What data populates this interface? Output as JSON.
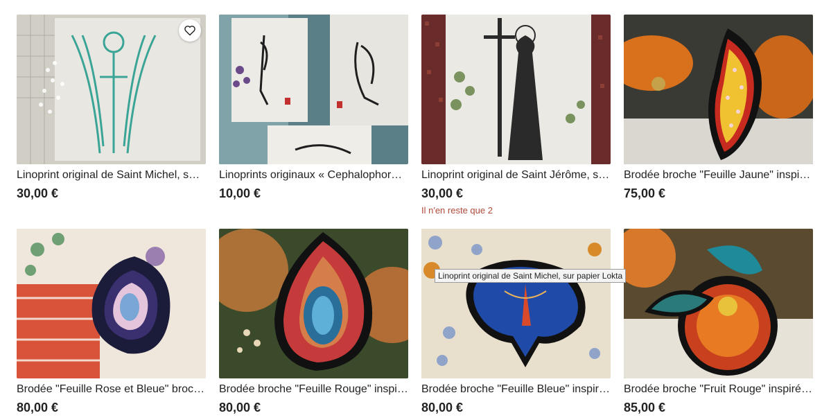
{
  "listings": [
    {
      "title": "Linoprint original de Saint Michel, su…",
      "price": "30,00 €"
    },
    {
      "title": "Linoprints originaux « Cephalophore…",
      "price": "10,00 €"
    },
    {
      "title": "Linoprint original de Saint Jérôme, s…",
      "price": "30,00 €",
      "stock": "Il n'en reste que 2"
    },
    {
      "title": "Brodée broche \"Feuille Jaune\" inspir…",
      "price": "75,00 €"
    },
    {
      "title": "Brodée \"Feuille Rose et Bleue\" broch…",
      "price": "80,00 €"
    },
    {
      "title": "Brodée broche \"Feuille Rouge\" inspir…",
      "price": "80,00 €"
    },
    {
      "title": "Brodée broche \"Feuille Bleue\" inspir…",
      "price": "80,00 €"
    },
    {
      "title": "Brodée broche \"Fruit Rouge\" inspiré …",
      "price": "85,00 €"
    }
  ],
  "tooltip": "Linoprint original de Saint Michel, sur papier Lokta",
  "icons": {
    "favorite": "heart-outline-icon"
  },
  "colors": {
    "stock_warning": "#b04a3a",
    "text": "#222222"
  }
}
